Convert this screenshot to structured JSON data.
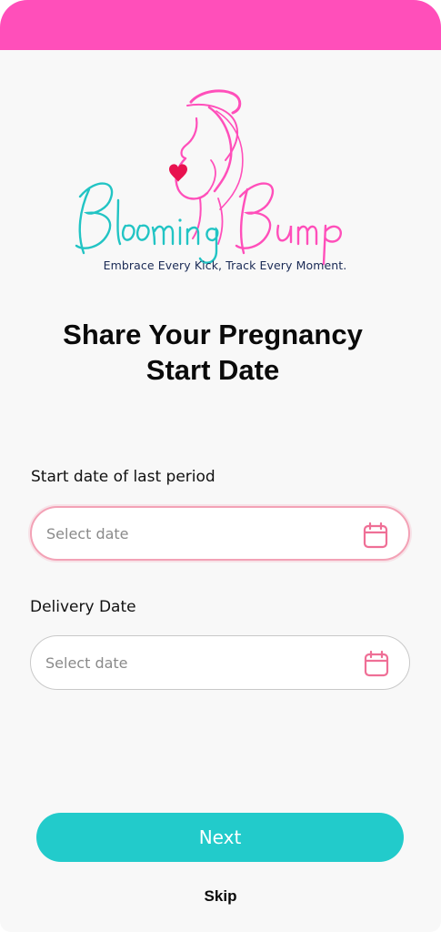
{
  "header": {
    "brand_name": "Blooming Bump",
    "brand_colors": {
      "bar": "#ff4fba",
      "pink": "#ff4fba",
      "teal": "#22c4c4",
      "heart": "#e8124f"
    },
    "tagline": "Embrace Every Kick, Track Every Moment."
  },
  "main": {
    "title_line1": "Share Your Pregnancy",
    "title_line2": "Start Date"
  },
  "form": {
    "last_period": {
      "label": "Start date of last period",
      "value": "",
      "placeholder": "Select date",
      "icon": "calendar-icon"
    },
    "delivery": {
      "label": "Delivery Date",
      "value": "",
      "placeholder": "Select date",
      "icon": "calendar-icon"
    }
  },
  "actions": {
    "next_label": "Next",
    "skip_label": "Skip",
    "primary_color": "#22cbcb"
  }
}
